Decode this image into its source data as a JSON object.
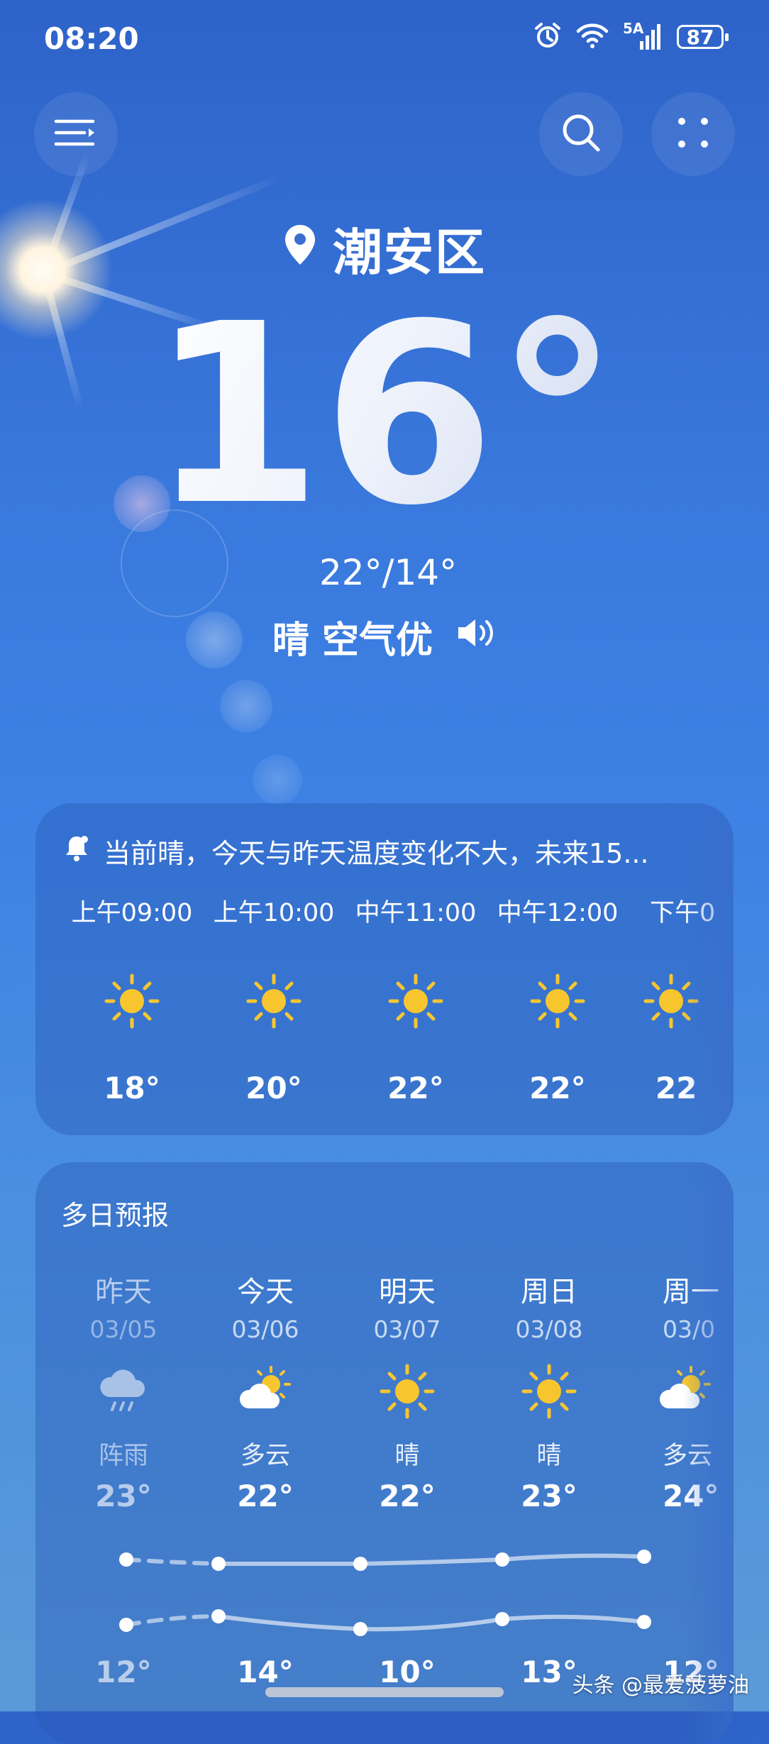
{
  "status_bar": {
    "time": "08:20",
    "network": "5A",
    "battery": "87",
    "icons": [
      "alarm-icon",
      "wifi-icon",
      "cellular-signal-icon",
      "battery-icon"
    ]
  },
  "top_bar": {
    "menu_icon": "menu-icon",
    "search_icon": "search-icon",
    "more_icon": "more-dots-icon"
  },
  "location": "潮安区",
  "current": {
    "temperature": "16°",
    "high_low": "22°/14°",
    "condition": "晴 空气优"
  },
  "hourly_card": {
    "notice": "当前晴，今天与昨天温度变化不大，未来15...",
    "hours": [
      {
        "time": "上午09:00",
        "icon": "sun-icon",
        "temp": "18°"
      },
      {
        "time": "上午10:00",
        "icon": "sun-icon",
        "temp": "20°"
      },
      {
        "time": "中午11:00",
        "icon": "sun-icon",
        "temp": "22°"
      },
      {
        "time": "中午12:00",
        "icon": "sun-icon",
        "temp": "22°"
      },
      {
        "time": "下午0",
        "icon": "sun-icon",
        "temp": "22"
      }
    ]
  },
  "daily_card": {
    "title": "多日预报",
    "days": [
      {
        "name": "昨天",
        "date": "03/05",
        "icon": "rain-cloud-icon",
        "condition": "阵雨",
        "high": "23°",
        "low": "12°"
      },
      {
        "name": "今天",
        "date": "03/06",
        "icon": "partly-cloudy-icon",
        "condition": "多云",
        "high": "22°",
        "low": "14°"
      },
      {
        "name": "明天",
        "date": "03/07",
        "icon": "sun-icon",
        "condition": "晴",
        "high": "22°",
        "low": "10°"
      },
      {
        "name": "周日",
        "date": "03/08",
        "icon": "sun-icon",
        "condition": "晴",
        "high": "23°",
        "low": "13°"
      },
      {
        "name": "周一",
        "date": "03/0",
        "icon": "partly-cloudy-icon",
        "condition": "多云",
        "high": "24°",
        "low": "12°"
      }
    ]
  },
  "watermark": "头条 @最爱菠萝油",
  "colors": {
    "background_top": "#2e63c9",
    "background_bottom": "#5b9ad8",
    "sun_yellow": "#f7c62f"
  }
}
